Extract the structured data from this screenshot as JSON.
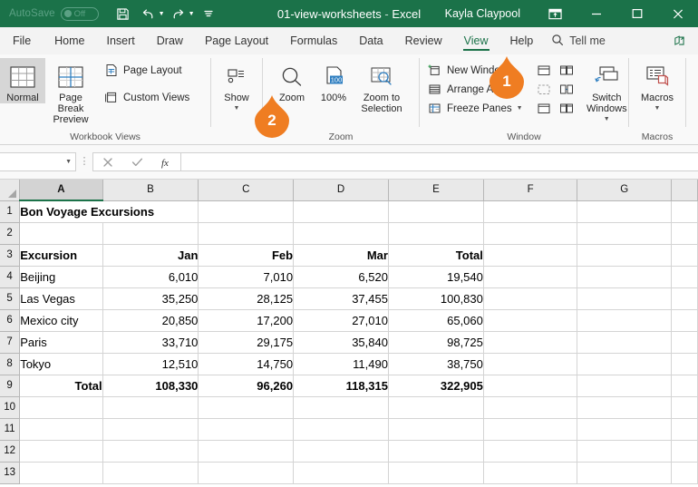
{
  "titlebar": {
    "autosave_label": "AutoSave",
    "autosave_state": "Off",
    "save_icon": "save-icon",
    "undo_icon": "undo-icon",
    "redo_icon": "redo-icon",
    "customize_icon": "customize-quick-access-icon",
    "filename": "01-view-worksheets",
    "dash": "-",
    "app_name": "Excel",
    "user_name": "Kayla Claypool",
    "ribbon_display_icon": "ribbon-display-options-icon",
    "minimize_icon": "minimize-icon",
    "maximize_icon": "maximize-icon",
    "close_icon": "close-icon"
  },
  "tabs": [
    {
      "label": "File",
      "active": false
    },
    {
      "label": "Home",
      "active": false
    },
    {
      "label": "Insert",
      "active": false
    },
    {
      "label": "Draw",
      "active": false
    },
    {
      "label": "Page Layout",
      "active": false
    },
    {
      "label": "Formulas",
      "active": false
    },
    {
      "label": "Data",
      "active": false
    },
    {
      "label": "Review",
      "active": false
    },
    {
      "label": "View",
      "active": true
    },
    {
      "label": "Help",
      "active": false
    }
  ],
  "tellme": {
    "icon": "search-icon",
    "label": "Tell me"
  },
  "share": {
    "icon": "share-icon"
  },
  "ribbon": {
    "workbook_views": {
      "label": "Workbook Views",
      "normal": "Normal",
      "page_break_preview": "Page Break Preview",
      "page_layout": "Page Layout",
      "custom_views": "Custom Views"
    },
    "show": {
      "label": "Show",
      "button": "Show"
    },
    "zoom": {
      "label": "Zoom",
      "zoom": "Zoom",
      "hundred": "100%",
      "hundred_badge": "100",
      "zoom_to_selection": "Zoom to Selection"
    },
    "window": {
      "label": "Window",
      "new_window": "New Window",
      "arrange_all": "Arrange All",
      "freeze_panes": "Freeze Panes",
      "switch_windows": "Switch Windows",
      "split_icon": "split-icon",
      "hide_icon": "hide-window-icon",
      "unhide_icon": "unhide-window-icon",
      "side_by_side_icon": "view-side-by-side-icon",
      "sync_scrolling_icon": "synchronous-scrolling-icon",
      "reset_position_icon": "reset-window-position-icon"
    },
    "macros": {
      "label": "Macros",
      "button": "Macros"
    }
  },
  "formula_bar": {
    "name_box_value": "",
    "cancel_icon": "cancel-icon",
    "enter_icon": "enter-icon",
    "function_icon": "insert-function-icon",
    "formula_value": ""
  },
  "sheet": {
    "columns": [
      "A",
      "B",
      "C",
      "D",
      "E",
      "F",
      "G"
    ],
    "selected_column": "A",
    "rows": [
      "1",
      "2",
      "3",
      "4",
      "5",
      "6",
      "7",
      "8",
      "9",
      "10",
      "11",
      "12",
      "13"
    ],
    "title": "Bon Voyage Excursions",
    "headers": [
      "Excursion",
      "Jan",
      "Feb",
      "Mar",
      "Total"
    ],
    "data_rows": [
      {
        "label": "Beijing",
        "jan": "6,010",
        "feb": "7,010",
        "mar": "6,520",
        "total": "19,540"
      },
      {
        "label": "Las Vegas",
        "jan": "35,250",
        "feb": "28,125",
        "mar": "37,455",
        "total": "100,830"
      },
      {
        "label": "Mexico city",
        "jan": "20,850",
        "feb": "17,200",
        "mar": "27,010",
        "total": "65,060"
      },
      {
        "label": "Paris",
        "jan": "33,710",
        "feb": "29,175",
        "mar": "35,840",
        "total": "98,725"
      },
      {
        "label": "Tokyo",
        "jan": "12,510",
        "feb": "14,750",
        "mar": "11,490",
        "total": "38,750"
      }
    ],
    "total_row": {
      "label": "Total",
      "jan": "108,330",
      "feb": "96,260",
      "mar": "118,315",
      "total": "322,905"
    }
  },
  "callouts": [
    {
      "number": "1",
      "target": "window-group"
    },
    {
      "number": "2",
      "target": "zoom-button"
    }
  ],
  "colors": {
    "brand_green": "#1b7249",
    "callout_orange": "#ef7d22",
    "ribbon_bg": "#f9f9f9",
    "tabbar_bg": "#f3f3f3",
    "header_gray": "#e9e9e9"
  }
}
